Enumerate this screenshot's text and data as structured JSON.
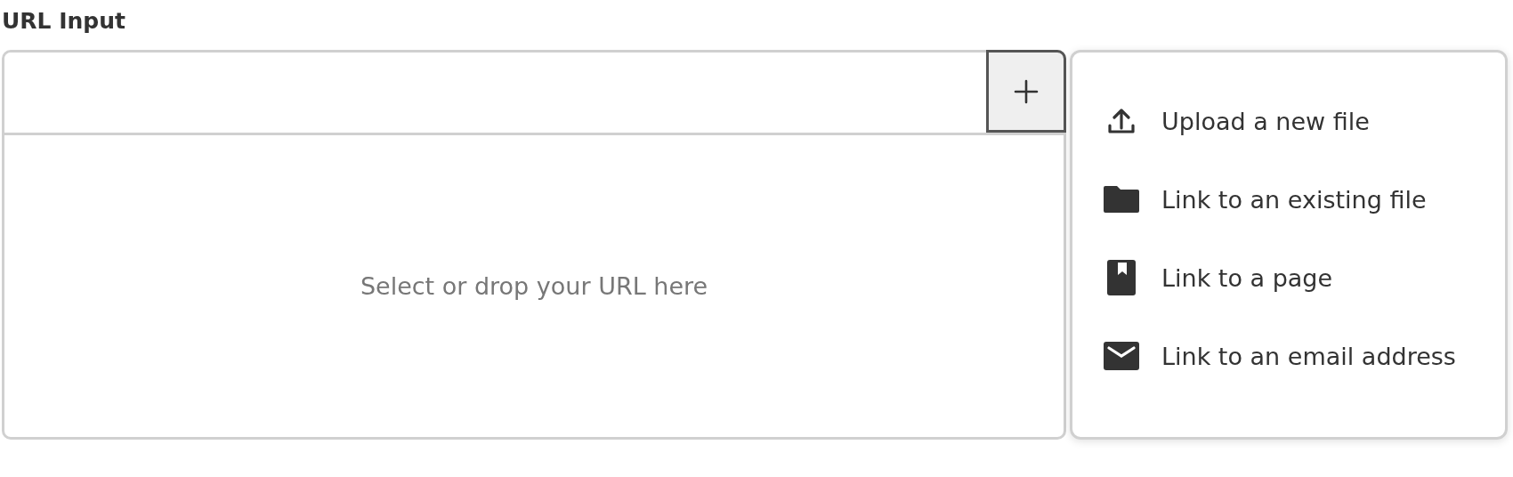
{
  "label": "URL Input",
  "drop_zone": {
    "placeholder": "Select or drop your URL here"
  },
  "menu": {
    "items": [
      {
        "kind": "upload",
        "label": "Upload a new file"
      },
      {
        "kind": "folder",
        "label": "Link to an existing file"
      },
      {
        "kind": "page",
        "label": "Link to a page"
      },
      {
        "kind": "email",
        "label": "Link to an email address"
      }
    ]
  }
}
